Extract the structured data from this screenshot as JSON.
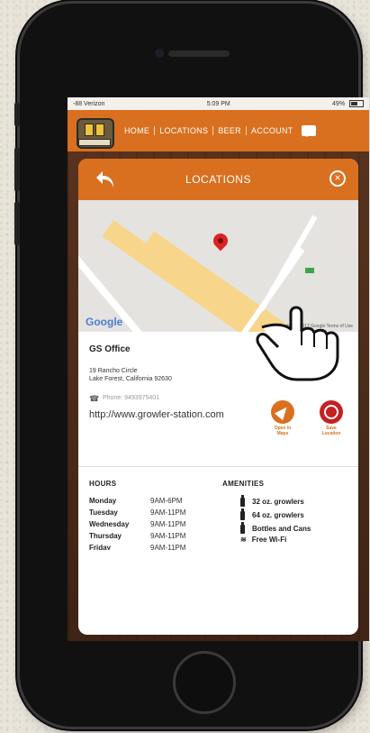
{
  "status_bar": {
    "carrier": "-88 Verizon",
    "time": "5:09 PM",
    "battery": "49%"
  },
  "nav": {
    "links": [
      "HOME",
      "LOCATIONS",
      "BEER",
      "ACCOUNT"
    ]
  },
  "modal": {
    "title": "LOCATIONS"
  },
  "map": {
    "provider": "Google",
    "attribution": "Map data ©2017 Google   Terms of Use"
  },
  "location": {
    "name": "GS Office",
    "address_line1": "19 Rancho Circle",
    "address_line2": "Lake Forest, California 92630",
    "phone": "Phone: 9493975401",
    "url": "http://www.growler-station.com"
  },
  "actions": {
    "open_label": "Open in Maps",
    "save_label": "Save Location"
  },
  "hours": {
    "heading": "HOURS",
    "rows": [
      {
        "day": "Monday",
        "time": "9AM-6PM"
      },
      {
        "day": "Tuesday",
        "time": "9AM-11PM"
      },
      {
        "day": "Wednesday",
        "time": "9AM-11PM"
      },
      {
        "day": "Thursday",
        "time": "9AM-11PM"
      },
      {
        "day": "Friday",
        "time": "9AM-11PM"
      }
    ]
  },
  "amenities": {
    "heading": "AMENITIES",
    "items": [
      "32 oz. growlers",
      "64 oz. growlers",
      "Bottles and Cans",
      "Free Wi-Fi"
    ]
  },
  "colors": {
    "accent": "#d9701f",
    "save": "#c62020"
  }
}
